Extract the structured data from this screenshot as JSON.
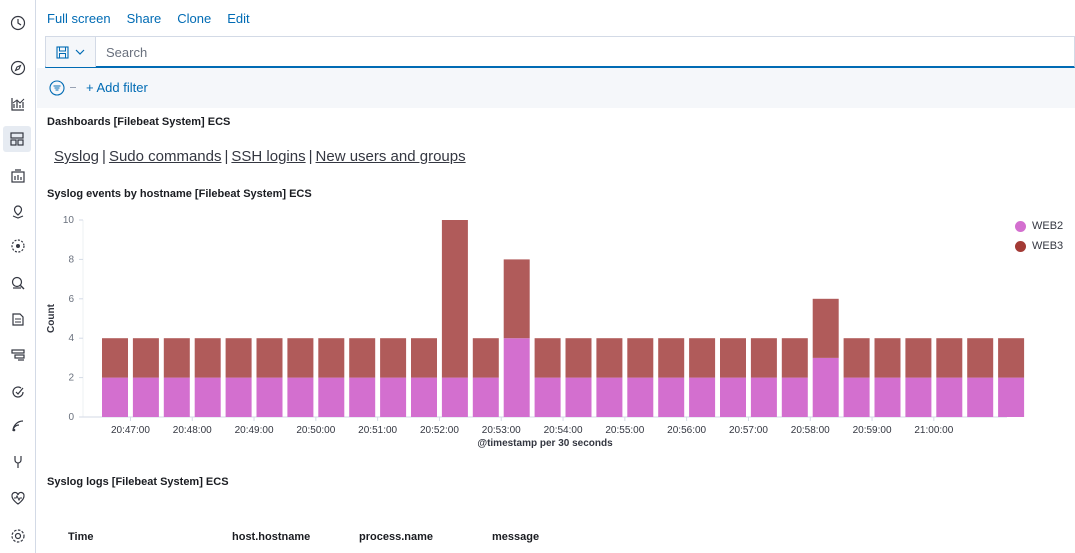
{
  "sidebar": {
    "icons": [
      "clock-icon",
      "compass-icon",
      "visualize-icon",
      "dashboard-icon",
      "canvas-icon",
      "maps-icon",
      "ml-icon",
      "infrastructure-icon",
      "logs-icon",
      "apm-icon",
      "uptime-icon",
      "siem-icon",
      "dev-tools-icon",
      "monitoring-icon",
      "management-icon"
    ]
  },
  "topnav": {
    "fullscreen": "Full screen",
    "share": "Share",
    "clone": "Clone",
    "edit": "Edit"
  },
  "search": {
    "placeholder": "Search"
  },
  "filter": {
    "add_label": "+ Add filter"
  },
  "panels": {
    "dashboards_title": "Dashboards [Filebeat System] ECS",
    "links": [
      "Syslog",
      "Sudo commands",
      "SSH logins",
      "New users and groups"
    ],
    "chart_title": "Syslog events by hostname [Filebeat System] ECS",
    "logs_title": "Syslog logs [Filebeat System] ECS"
  },
  "table": {
    "columns": [
      "Time",
      "host.hostname",
      "process.name",
      "message"
    ]
  },
  "colors": {
    "web2": "#d36fcf",
    "web3": "#b05b5a",
    "link": "#006bb4"
  },
  "chart_data": {
    "type": "bar",
    "stacked": true,
    "xlabel": "@timestamp per 30 seconds",
    "ylabel": "Count",
    "ylim": [
      0,
      10
    ],
    "yticks": [
      0,
      2,
      4,
      6,
      8,
      10
    ],
    "categories": [
      "20:46:30",
      "20:47:00",
      "20:47:30",
      "20:48:00",
      "20:48:30",
      "20:49:00",
      "20:49:30",
      "20:50:00",
      "20:50:30",
      "20:51:00",
      "20:51:30",
      "20:52:00",
      "20:52:30",
      "20:53:00",
      "20:53:30",
      "20:54:00",
      "20:54:30",
      "20:55:00",
      "20:55:30",
      "20:56:00",
      "20:56:30",
      "20:57:00",
      "20:57:30",
      "20:58:00",
      "20:58:30",
      "20:59:00",
      "20:59:30",
      "21:00:00",
      "21:00:30",
      "21:01:00"
    ],
    "xtick_labels": [
      "20:47:00",
      "20:48:00",
      "20:49:00",
      "20:50:00",
      "20:51:00",
      "20:52:00",
      "20:53:00",
      "20:54:00",
      "20:55:00",
      "20:56:00",
      "20:57:00",
      "20:58:00",
      "20:59:00",
      "21:00:00"
    ],
    "legend_position": "top-right",
    "series": [
      {
        "name": "WEB2",
        "color": "#d36fcf",
        "values": [
          2,
          2,
          2,
          2,
          2,
          2,
          2,
          2,
          2,
          2,
          2,
          2,
          2,
          4,
          2,
          2,
          2,
          2,
          2,
          2,
          2,
          2,
          2,
          3,
          2,
          2,
          2,
          2,
          2,
          2
        ]
      },
      {
        "name": "WEB3",
        "color": "#b05b5a",
        "values": [
          2,
          2,
          2,
          2,
          2,
          2,
          2,
          2,
          2,
          2,
          2,
          8,
          2,
          4,
          2,
          2,
          2,
          2,
          2,
          2,
          2,
          2,
          2,
          3,
          2,
          2,
          2,
          2,
          2,
          2
        ]
      }
    ]
  }
}
